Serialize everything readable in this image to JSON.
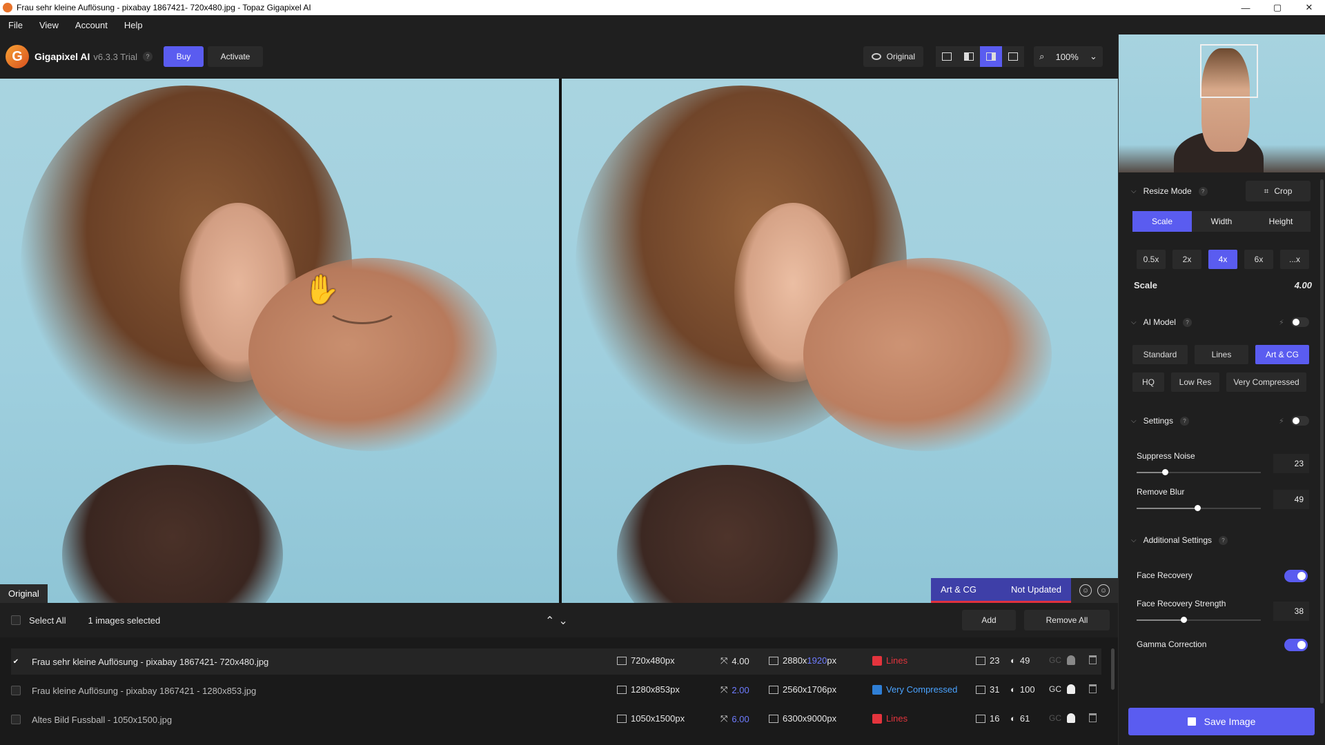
{
  "window": {
    "title": "Frau sehr kleine Auflösung - pixabay 1867421- 720x480.jpg - Topaz Gigapixel AI",
    "minimize": "—",
    "maximize": "▢",
    "close": "✕"
  },
  "menu": [
    "File",
    "View",
    "Account",
    "Help"
  ],
  "toolbar": {
    "logo_letter": "G",
    "app_name": "Gigapixel AI",
    "version": "v6.3.3 Trial",
    "help": "?",
    "buy": "Buy",
    "activate": "Activate",
    "original": "Original",
    "zoom": "100%",
    "zoom_caret": "⌄"
  },
  "preview": {
    "left_label": "Original",
    "model_tag": "Art & CG",
    "status_tag": "Not Updated"
  },
  "batch": {
    "select_all": "Select All",
    "selected_count": "1 images selected",
    "arrows": "⌃⌄",
    "add": "Add",
    "remove_all": "Remove All"
  },
  "files": [
    {
      "name": "Frau sehr kleine Auflösung - pixabay 1867421- 720x480.jpg",
      "checked": "✔",
      "input_size": "720x480px",
      "scale": "4.00",
      "out_w": "2880x",
      "out_h": "1920",
      "out_unit": "px",
      "model": "Lines",
      "noise": "23",
      "blur": "49",
      "gc": "GC"
    },
    {
      "name": "Frau kleine Auflösung - pixabay 1867421 - 1280x853.jpg",
      "checked": "",
      "input_size": "1280x853px",
      "scale": "2.00",
      "out": "2560x1706px",
      "model": "Very Compressed",
      "noise": "31",
      "blur": "100",
      "gc": "GC"
    },
    {
      "name": "Altes Bild Fussball - 1050x1500.jpg",
      "checked": "",
      "input_size": "1050x1500px",
      "scale": "6.00",
      "out": "6300x9000px",
      "model": "Lines",
      "noise": "16",
      "blur": "61",
      "gc": "GC"
    }
  ],
  "panel": {
    "resize_mode": "Resize Mode",
    "crop": "Crop",
    "modes": [
      "Scale",
      "Width",
      "Height"
    ],
    "scale_chips": [
      "0.5x",
      "2x",
      "4x",
      "6x",
      "...x"
    ],
    "scale_label": "Scale",
    "scale_value": "4.00",
    "ai_model": "AI Model",
    "models_row1": [
      "Standard",
      "Lines",
      "Art & CG"
    ],
    "models_row2": [
      "HQ",
      "Low Res",
      "Very Compressed"
    ],
    "settings": "Settings",
    "suppress_noise": "Suppress Noise",
    "suppress_noise_value": "23",
    "remove_blur": "Remove Blur",
    "remove_blur_value": "49",
    "additional_settings": "Additional Settings",
    "face_recovery": "Face Recovery",
    "face_recovery_strength": "Face Recovery Strength",
    "face_recovery_strength_value": "38",
    "gamma_correction": "Gamma Correction",
    "save": "Save Image",
    "chevron": "⌵",
    "q": "?",
    "bolt": "⚡"
  },
  "colors": {
    "accent": "#5a5cf0",
    "error": "#e4343d",
    "link": "#4aa3ff"
  }
}
